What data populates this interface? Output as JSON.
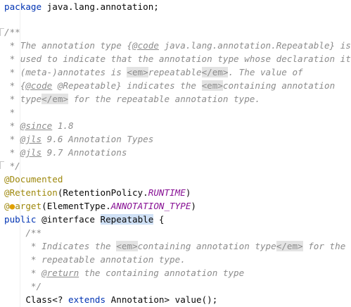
{
  "editor": {
    "package_kw": "package",
    "package_name": " java.lang.annotation;",
    "doc_open": "/**",
    "doc_l1a": " * The annotation type {",
    "doc_l1_code": "@code",
    "doc_l1b": " java.lang.annotation.Repeatable} is",
    "doc_l2": " * used to indicate that the annotation type whose declaration it",
    "doc_l3a": " * (meta-)annotates is ",
    "tag_em_open": "<em>",
    "doc_l3b": "repeatable",
    "tag_em_close": "</em>",
    "doc_l3c": ". The value of",
    "doc_l4a": " * {",
    "doc_l4_code": "@code",
    "doc_l4b": " @Repeatable} indicates the ",
    "doc_l4c": "containing annotation",
    "doc_l5a": " * type",
    "doc_l5b": " for the repeatable annotation type.",
    "doc_star": " *",
    "doc_since_pre": " * ",
    "since_tag": "@since",
    "since_val": " 1.8",
    "jls_tag": "@jls",
    "jls_1": " 9.6 Annotation Types",
    "jls_2": " 9.7 Annotations",
    "doc_close": " */",
    "ann_documented": "@Documented",
    "ann_retention": "@Retention",
    "retention_args_a": "(RetentionPolicy.",
    "retention_const": "RUNTIME",
    "retention_args_b": ")",
    "ann_target_a": "@",
    "ann_target_b": "arget",
    "target_args_a": "(ElementType.",
    "target_const": "ANNOTATION_TYPE",
    "target_args_b": ")",
    "public_kw": "public",
    "interface_kw": " @interface ",
    "class_name": "Repeatable",
    "class_open": " {",
    "m_doc_open": "    /**",
    "m_doc_l1a": "     * Indicates the ",
    "m_doc_l1b": "containing annotation type",
    "m_doc_l1c": " for the",
    "m_doc_l2": "     * repeatable annotation type.",
    "m_doc_l3a": "     * ",
    "return_tag": "@return",
    "m_doc_l3b": " the containing annotation type",
    "m_doc_close": "     */",
    "method_a": "    Class<? ",
    "extends_kw": "extends",
    "method_b": " Annotation> value();"
  }
}
